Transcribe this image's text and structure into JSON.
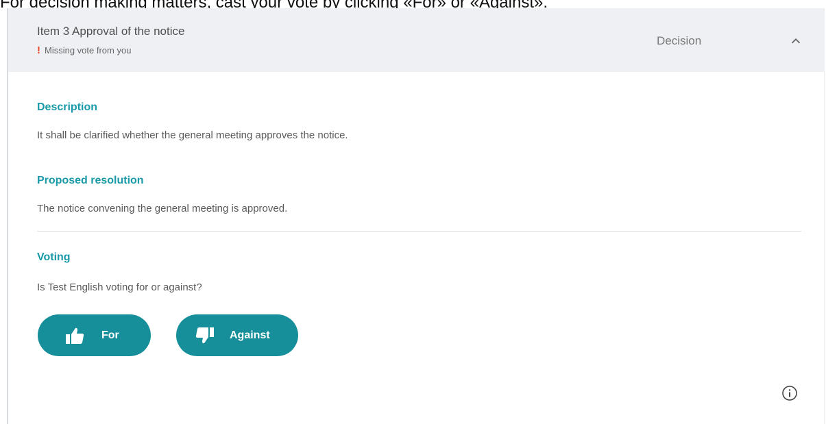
{
  "instruction": "For decision making matters, cast your vote by clicking «For» or «Against».",
  "item": {
    "title": "Item 3 Approval of the notice",
    "missing_vote": "Missing vote from you",
    "type": "Decision"
  },
  "description": {
    "title": "Description",
    "text": "It shall be clarified whether the general meeting approves the notice."
  },
  "resolution": {
    "title": "Proposed resolution",
    "text": "The notice convening the general meeting is approved."
  },
  "voting": {
    "title": "Voting",
    "question": "Is Test English voting for or against?",
    "for_label": "For",
    "against_label": "Against"
  },
  "icons": {
    "chevron": "chevron-up-icon",
    "missing": "exclamation-icon",
    "for": "thumbs-up-icon",
    "against": "thumbs-down-icon",
    "info": "info-icon"
  },
  "colors": {
    "accent": "#1a9aa8",
    "button": "#168f9b",
    "warning": "#e8442a",
    "header_bg": "#eef0f4"
  }
}
